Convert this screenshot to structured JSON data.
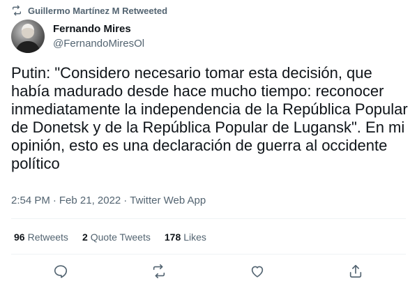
{
  "retweet_context": {
    "text": "Guillermo Martínez M Retweeted",
    "icon": "retweet-icon"
  },
  "author": {
    "name": "Fernando Mires",
    "handle": "@FernandoMiresOl"
  },
  "tweet": {
    "text": "Putin: \"Considero necesario tomar esta decisión, que había madurado desde hace mucho tiempo: reconocer inmediatamente la independencia de la República Popular de Donetsk y de la República Popular de Lugansk\". En mi opinión, esto es una declaración de guerra al occidente político",
    "time": "2:54 PM",
    "date": "Feb 21, 2022",
    "source": "Twitter Web App"
  },
  "stats": {
    "retweets_count": "96",
    "retweets_label": "Retweets",
    "quote_count": "2",
    "quote_label": "Quote Tweets",
    "likes_count": "178",
    "likes_label": "Likes"
  },
  "actions": {
    "reply_icon": "reply-icon",
    "retweet_icon": "retweet-icon",
    "like_icon": "heart-icon",
    "share_icon": "share-icon"
  },
  "colors": {
    "text_primary": "#0f1419",
    "text_secondary": "#536471",
    "divider": "#eff3f4"
  }
}
